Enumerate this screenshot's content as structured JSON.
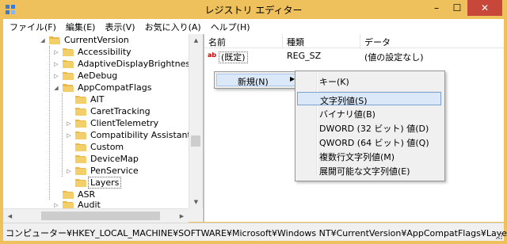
{
  "window": {
    "title": "レジストリ エディター"
  },
  "window_buttons": {
    "minimize": "–",
    "maximize": "☐",
    "close": "✕"
  },
  "menu": [
    {
      "label": "ファイル(F)"
    },
    {
      "label": "編集(E)"
    },
    {
      "label": "表示(V)"
    },
    {
      "label": "お気に入り(A)"
    },
    {
      "label": "ヘルプ(H)"
    }
  ],
  "tree": {
    "items": [
      {
        "label": "CurrentVersion",
        "state": "expanded"
      },
      {
        "label": "Accessibility",
        "state": "collapsed"
      },
      {
        "label": "AdaptiveDisplayBrightness",
        "state": "collapsed"
      },
      {
        "label": "AeDebug",
        "state": "collapsed"
      },
      {
        "label": "AppCompatFlags",
        "state": "expanded"
      },
      {
        "label": "AIT",
        "state": "leaf"
      },
      {
        "label": "CaretTracking",
        "state": "leaf"
      },
      {
        "label": "ClientTelemetry",
        "state": "collapsed"
      },
      {
        "label": "Compatibility Assistant",
        "state": "collapsed"
      },
      {
        "label": "Custom",
        "state": "leaf"
      },
      {
        "label": "DeviceMap",
        "state": "leaf"
      },
      {
        "label": "PenService",
        "state": "collapsed"
      },
      {
        "label": "Layers",
        "state": "selected"
      },
      {
        "label": "ASR",
        "state": "leaf"
      },
      {
        "label": "Audit",
        "state": "collapsed"
      }
    ]
  },
  "list": {
    "columns": {
      "name": "名前",
      "type": "種類",
      "data": "データ"
    },
    "rows": [
      {
        "icon": "ab",
        "name": "(既定)",
        "type": "REG_SZ",
        "data": "(値の設定なし)"
      }
    ]
  },
  "context_menu": {
    "new_label": "新規(N)",
    "arrow": "▶"
  },
  "submenu": {
    "items": [
      {
        "label": "キー(K)"
      },
      {
        "label": "文字列値(S)"
      },
      {
        "label": "バイナリ値(B)"
      },
      {
        "label": "DWORD (32 ビット) 値(D)"
      },
      {
        "label": "QWORD (64 ビット) 値(Q)"
      },
      {
        "label": "複数行文字列値(M)"
      },
      {
        "label": "展開可能な文字列値(E)"
      }
    ]
  },
  "statusbar": {
    "path": "コンピューター¥HKEY_LOCAL_MACHINE¥SOFTWARE¥Microsoft¥Windows NT¥CurrentVersion¥AppCompatFlags¥Layers"
  },
  "colors": {
    "frame": "#eec15c",
    "close": "#c7483a",
    "highlight": "#dbe8f7",
    "folder": "#e8b84a"
  }
}
